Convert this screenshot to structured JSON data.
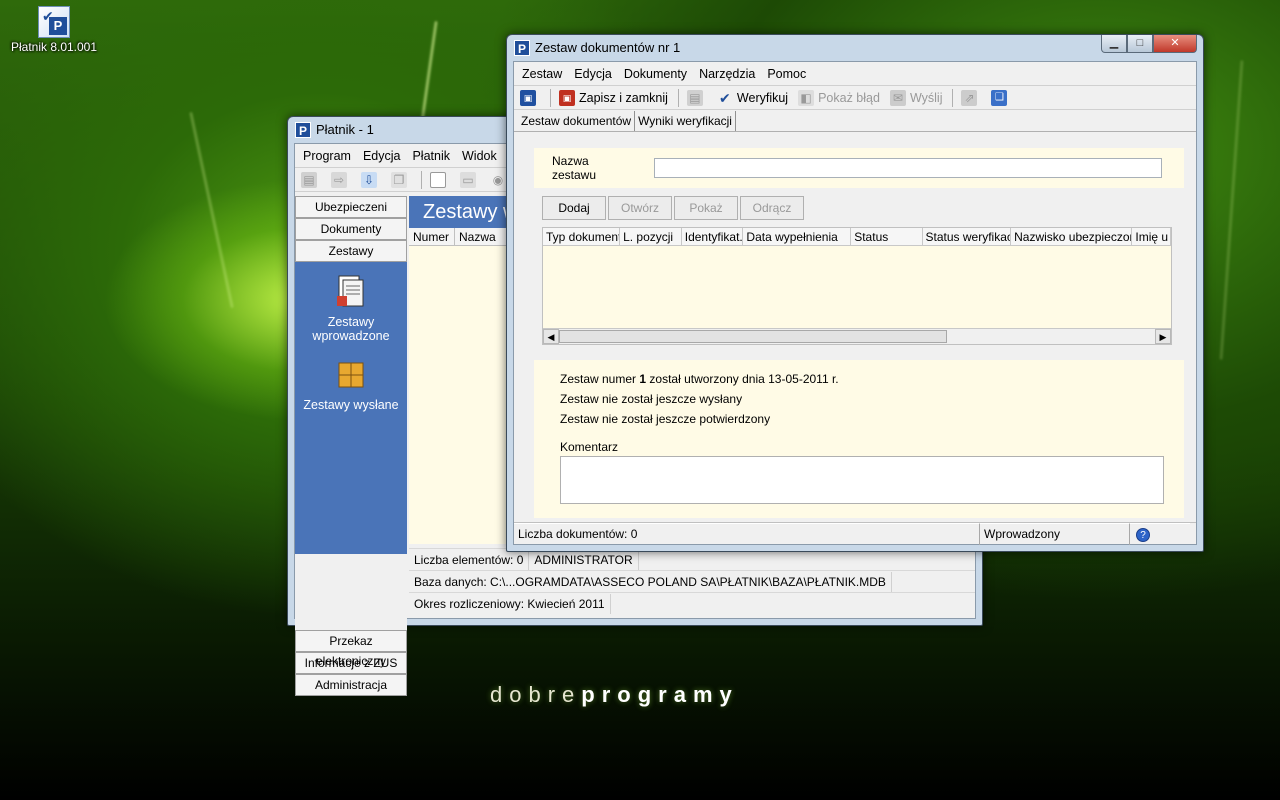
{
  "desktop": {
    "icon_label": "Płatnik 8.01.001",
    "brand_light": "dobre",
    "brand_bold": "programy"
  },
  "back_window": {
    "title": "Płatnik - 1",
    "menu": [
      "Program",
      "Edycja",
      "Płatnik",
      "Widok"
    ],
    "nav_top": [
      "Ubezpieczeni",
      "Dokumenty",
      "Zestawy"
    ],
    "nav_panel": [
      "Zestawy wprowadzone",
      "Zestawy wysłane"
    ],
    "nav_bottom": [
      "Przekaz elektroniczny",
      "Informacje z ZUS",
      "Administracja"
    ],
    "header": "Zestawy w",
    "grid_cols": [
      "Numer",
      "Nazwa"
    ],
    "status": {
      "elements": "Liczba elementów: 0",
      "user": "ADMINISTRATOR",
      "database": "Baza danych: C:\\...OGRAMDATA\\ASSECO POLAND SA\\PŁATNIK\\BAZA\\PŁATNIK.MDB",
      "period": "Okres rozliczeniowy: Kwiecień 2011"
    }
  },
  "front_window": {
    "title": "Zestaw dokumentów nr 1",
    "menu": [
      "Zestaw",
      "Edycja",
      "Dokumenty",
      "Narzędzia",
      "Pomoc"
    ],
    "toolbar": {
      "save_close": "Zapisz i zamknij",
      "verify": "Weryfikuj",
      "show_error": "Pokaż błąd",
      "send": "Wyślij"
    },
    "tabs": [
      "Zestaw dokumentów",
      "Wyniki weryfikacji"
    ],
    "name_label": "Nazwa zestawu",
    "name_value": "",
    "buttons": [
      "Dodaj",
      "Otwórz",
      "Pokaż",
      "Odrącz"
    ],
    "grid_cols": [
      "Typ dokumentu",
      "L. pozycji",
      "Identyfikat...",
      "Data wypełnienia",
      "Status",
      "Status weryfikacji",
      "Nazwisko ubezpieczon...",
      "Imię u"
    ],
    "info": {
      "created_prefix": "Zestaw numer",
      "created_num": "1",
      "created_suffix": "został utworzony dnia 13-05-2011 r.",
      "not_sent": "Zestaw nie został jeszcze wysłany",
      "not_confirmed": "Zestaw nie został jeszcze potwierdzony",
      "comment_label": "Komentarz"
    },
    "status": {
      "doc_count": "Liczba dokumentów: 0",
      "state": "Wprowadzony"
    }
  }
}
